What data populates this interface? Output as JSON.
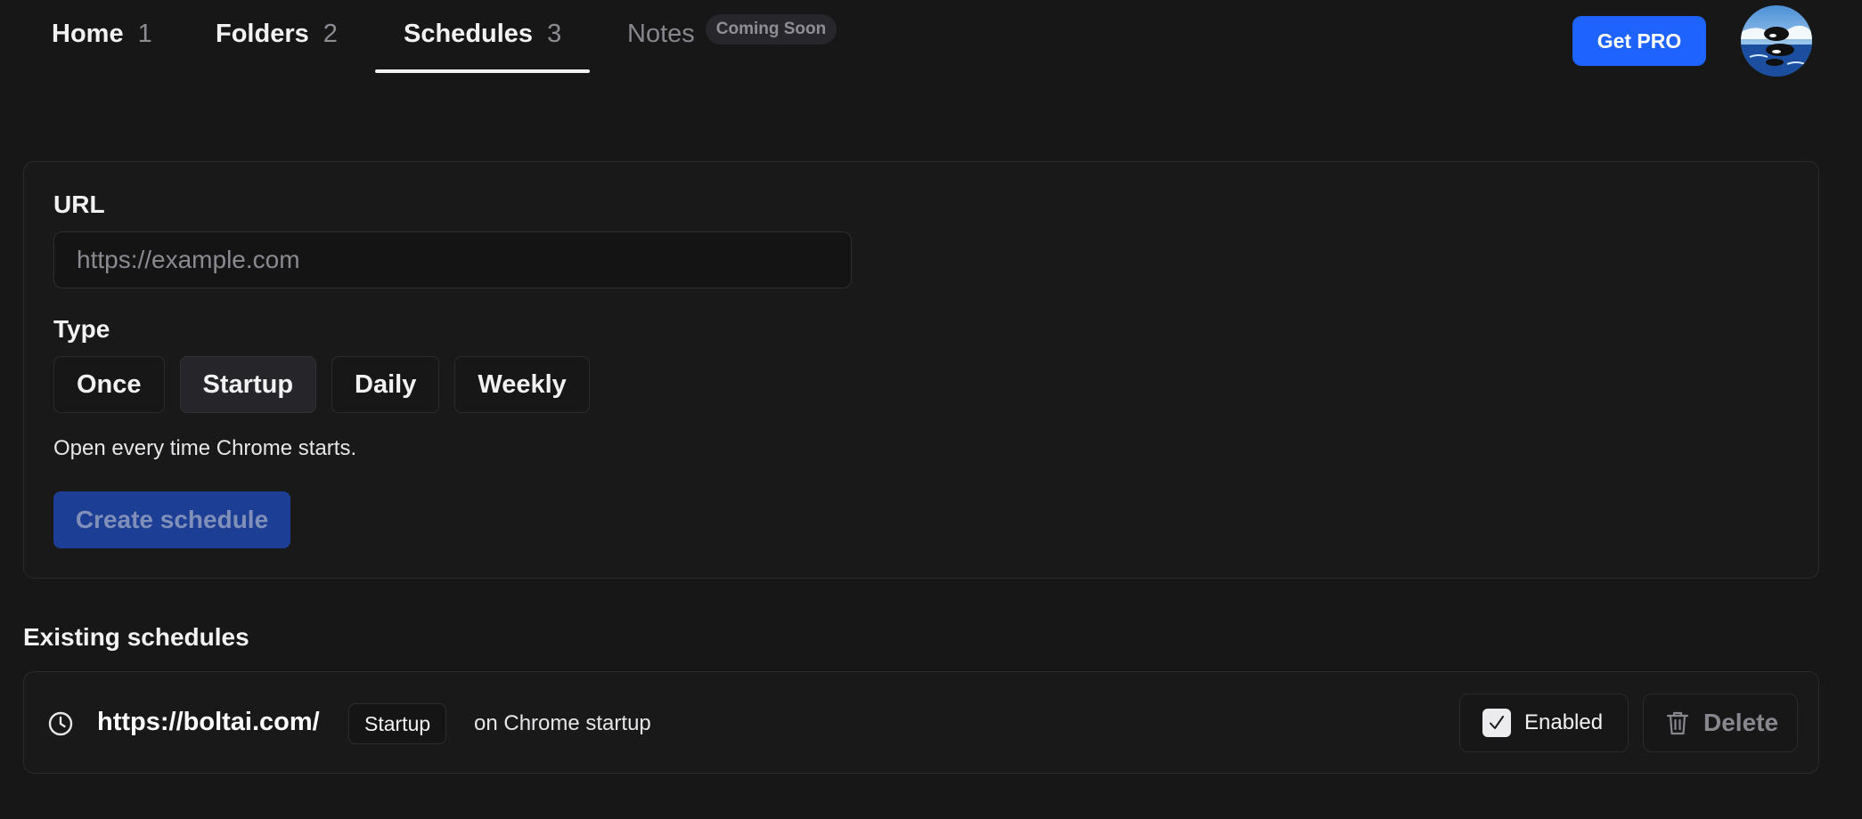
{
  "nav": {
    "tabs": [
      {
        "label": "Home",
        "count": "1"
      },
      {
        "label": "Folders",
        "count": "2"
      },
      {
        "label": "Schedules",
        "count": "3"
      },
      {
        "label": "Notes",
        "badge": "Coming Soon"
      }
    ],
    "active_tab": "Schedules",
    "get_pro_label": "Get PRO",
    "avatar_icon": "orca-avatar-icon"
  },
  "form": {
    "url_label": "URL",
    "url_value": "",
    "url_placeholder": "https://example.com",
    "type_label": "Type",
    "types": [
      "Once",
      "Startup",
      "Daily",
      "Weekly"
    ],
    "selected_type": "Startup",
    "helper_text": "Open every time Chrome starts.",
    "create_label": "Create schedule"
  },
  "existing": {
    "title": "Existing schedules",
    "items": [
      {
        "icon": "clock-icon",
        "url": "https://boltai.com/",
        "type": "Startup",
        "description": "on Chrome startup",
        "enabled_label": "Enabled",
        "enabled": true,
        "delete_label": "Delete"
      }
    ]
  },
  "colors": {
    "background": "#171718",
    "accent": "#1f63ff",
    "create_disabled": "#1d3e95"
  }
}
